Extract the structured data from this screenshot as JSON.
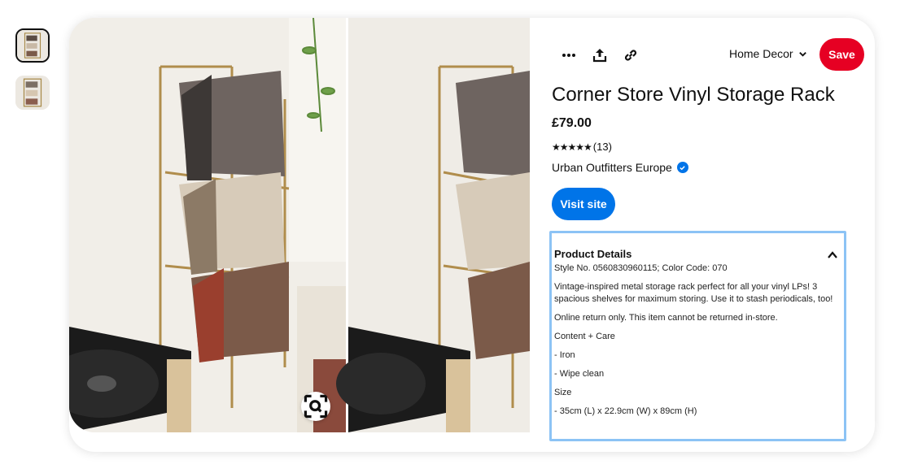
{
  "toolbar": {
    "more_icon": "more-dots-icon",
    "share_icon": "share-icon",
    "link_icon": "link-icon",
    "board_label": "Home Decor",
    "save_label": "Save"
  },
  "product": {
    "title": "Corner Store Vinyl Storage Rack",
    "price": "£79.00",
    "rating_stars": "★★★★★",
    "rating": 4.5,
    "review_count": "(13)",
    "merchant": "Urban Outfitters Europe",
    "visit_label": "Visit site"
  },
  "details": {
    "heading": "Product Details",
    "style_line": "Style No. 0560830960115; Color Code: 070",
    "description": "Vintage-inspired metal storage rack perfect for all your vinyl LPs! 3 spacious shelves for maximum storing. Use it to stash periodicals, too!",
    "returns": "Online return only. This item cannot be returned in-store.",
    "care_heading": "Content + Care",
    "care_1": "- Iron",
    "care_2": "- Wipe clean",
    "size_heading": "Size",
    "size_value": "- 35cm (L) x 22.9cm (W) x 89cm (H)"
  },
  "colors": {
    "save": "#e60023",
    "visit": "#0074e8",
    "focus_border": "#8cc3f5"
  }
}
